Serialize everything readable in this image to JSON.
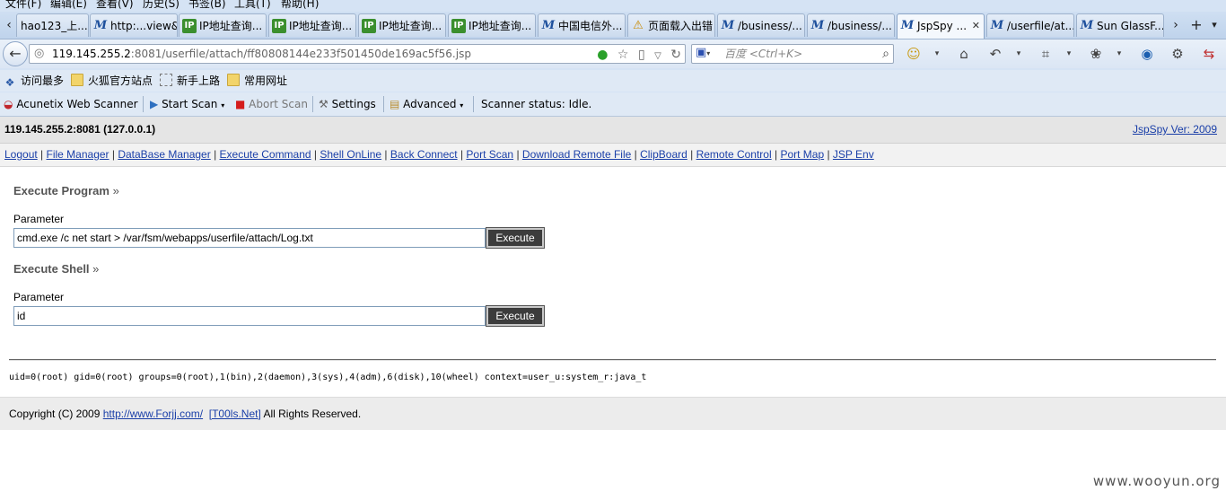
{
  "menu": [
    "文件(F)",
    "编辑(E)",
    "查看(V)",
    "历史(S)",
    "书签(B)",
    "工具(T)",
    "帮助(H)"
  ],
  "tabs": [
    {
      "title": "hao123_上...",
      "icon": "none"
    },
    {
      "title": "http:...view&",
      "icon": "m-icon"
    },
    {
      "title": "IP地址查询...",
      "icon": "ip-icon"
    },
    {
      "title": "IP地址查询...",
      "icon": "ip-icon"
    },
    {
      "title": "IP地址查询...",
      "icon": "ip-icon"
    },
    {
      "title": "IP地址查询...",
      "icon": "ip-icon"
    },
    {
      "title": "中国电信外...",
      "icon": "m-icon"
    },
    {
      "title": "页面载入出错",
      "icon": "warning-icon"
    },
    {
      "title": "/business/...",
      "icon": "m-icon"
    },
    {
      "title": "/business/...",
      "icon": "m-icon"
    },
    {
      "title": "JspSpy ...",
      "icon": "m-icon",
      "active": true
    },
    {
      "title": "/userfile/at...",
      "icon": "m-icon"
    },
    {
      "title": "Sun GlassF...",
      "icon": "m-icon"
    }
  ],
  "address": {
    "host": "119.145.255.2",
    "rest": ":8081/userfile/attach/ff80808144e233f501450de169ac5f56.jsp"
  },
  "search": {
    "engine": "百度",
    "placeholder": "百度 <Ctrl+K>"
  },
  "bookmarks": [
    "访问最多",
    "火狐官方站点",
    "新手上路",
    "常用网址"
  ],
  "scanner": {
    "name": "Acunetix Web Scanner",
    "start": "Start Scan",
    "abort": "Abort Scan",
    "settings": "Settings",
    "advanced": "Advanced",
    "status": "Scanner status: Idle."
  },
  "page": {
    "host_info": "119.145.255.2:8081 (127.0.0.1)",
    "version": "JspSpy Ver: 2009",
    "nav": [
      "Logout",
      "File Manager",
      "DataBase Manager",
      "Execute Command",
      "Shell OnLine",
      "Back Connect",
      "Port Scan",
      "Download Remote File",
      "ClipBoard",
      "Remote Control",
      "Port Map",
      "JSP Env"
    ],
    "program": {
      "title": "Execute Program",
      "arrow": "»",
      "label": "Parameter",
      "value": "cmd.exe /c net start > /var/fsm/webapps/userfile/attach/Log.txt",
      "button": "Execute"
    },
    "shell": {
      "title": "Execute Shell",
      "arrow": "»",
      "label": "Parameter",
      "value": "id",
      "button": "Execute"
    },
    "output": "uid=0(root) gid=0(root) groups=0(root),1(bin),2(daemon),3(sys),4(adm),6(disk),10(wheel) context=user_u:system_r:java_t",
    "footer": {
      "copyright": "Copyright (C) 2009",
      "link1": "http://www.Forjj.com/",
      "link2": "[T00ls.Net]",
      "rights": "All Rights Reserved."
    }
  },
  "watermark": "www.wooyun.org"
}
